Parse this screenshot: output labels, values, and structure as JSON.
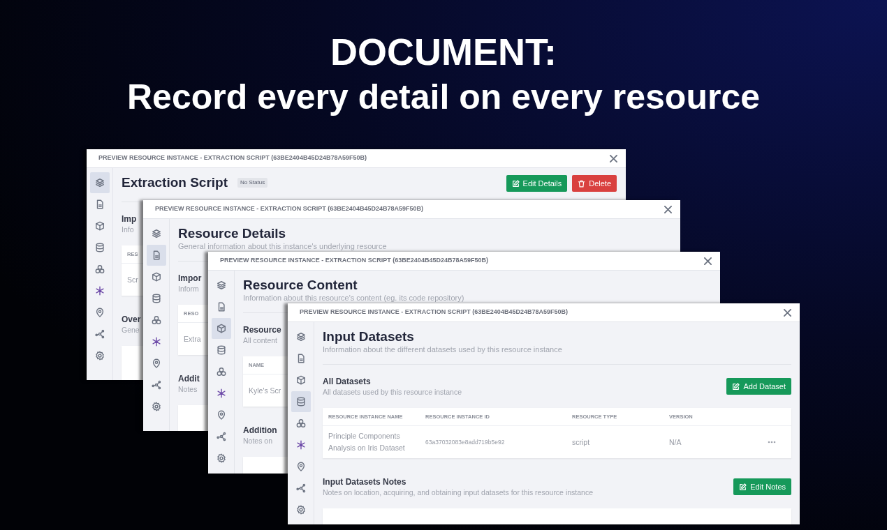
{
  "headline": {
    "title": "DOCUMENT:",
    "subtitle": "Record every detail on every resource"
  },
  "windows": [
    {
      "title": "PREVIEW RESOURCE INSTANCE - EXTRACTION SCRIPT (63BE2404B45D24B78A59F50B)",
      "nav": [
        {
          "selected": true
        },
        {
          "selected": false
        },
        {
          "selected": false
        },
        {
          "selected": false
        },
        {
          "selected": false
        },
        {
          "selected": false
        },
        {
          "selected": false
        },
        {
          "selected": false
        },
        {
          "selected": false
        }
      ],
      "heading": "Extraction Script",
      "badge": "No Status",
      "buttons": [
        {
          "kind": "edit",
          "label": "Edit Details"
        },
        {
          "kind": "delete",
          "label": "Delete"
        }
      ],
      "sections": [
        {
          "heading": "Imp",
          "description": "Info",
          "card": {
            "kind": "table",
            "columns": [
              "RES"
            ],
            "rows": [
              {
                "cells": [
                  "Scr"
                ]
              }
            ]
          }
        },
        {
          "heading": "Over",
          "description": "Gene",
          "card": {
            "kind": "blank"
          }
        }
      ]
    },
    {
      "title": "PREVIEW RESOURCE INSTANCE - EXTRACTION SCRIPT (63BE2404B45D24B78A59F50B)",
      "nav": [
        {
          "selected": false
        },
        {
          "selected": true
        },
        {
          "selected": false
        },
        {
          "selected": false
        },
        {
          "selected": false
        },
        {
          "selected": false
        },
        {
          "selected": false
        },
        {
          "selected": false
        },
        {
          "selected": false
        }
      ],
      "heading": "Resource Details",
      "description": "General information about this instance's underlying resource",
      "sections": [
        {
          "heading": "Impor",
          "description": "Inform",
          "card": {
            "kind": "table",
            "columns": [
              "RESO"
            ],
            "rows": [
              {
                "cells": [
                  "Extra"
                ]
              }
            ]
          }
        },
        {
          "heading": "Addit",
          "description": "Notes",
          "card": {
            "kind": "blank"
          }
        }
      ]
    },
    {
      "title": "PREVIEW RESOURCE INSTANCE - EXTRACTION SCRIPT (63BE2404B45D24B78A59F50B)",
      "nav": [
        {
          "selected": false
        },
        {
          "selected": false
        },
        {
          "selected": true
        },
        {
          "selected": false
        },
        {
          "selected": false
        },
        {
          "selected": false
        },
        {
          "selected": false
        },
        {
          "selected": false
        },
        {
          "selected": false
        }
      ],
      "heading": "Resource Content",
      "description": "Information about this resource's content (eg. its code repository)",
      "sections": [
        {
          "heading": "Resource",
          "description": "All content",
          "card": {
            "kind": "table",
            "columns": [
              "NAME"
            ],
            "rows": [
              {
                "cells": [
                  "Kyle's Scr"
                ]
              }
            ]
          }
        },
        {
          "heading": "Addition",
          "description": "Notes on",
          "card": {
            "kind": "blank"
          }
        }
      ]
    },
    {
      "title": "PREVIEW RESOURCE INSTANCE - EXTRACTION SCRIPT (63BE2404B45D24B78A59F50B)",
      "nav": [
        {
          "selected": false
        },
        {
          "selected": false
        },
        {
          "selected": false
        },
        {
          "selected": true
        },
        {
          "selected": false
        },
        {
          "selected": false
        },
        {
          "selected": false
        },
        {
          "selected": false
        },
        {
          "selected": false
        }
      ],
      "heading": "Input Datasets",
      "description": "Information about the different datasets used by this resource instance",
      "sections": [
        {
          "heading": "All Datasets",
          "description": "All datasets used by this resource instance",
          "button": "Add Dataset",
          "card": {
            "kind": "table",
            "columns": [
              "RESOURCE INSTANCE NAME",
              "RESOURCE INSTANCE ID",
              "RESOURCE TYPE",
              "VERSION"
            ],
            "rows": [
              {
                "cells": [
                  "Principle Components Analysis on Iris Dataset",
                  "63a37032083e8add719b5e92",
                  "script",
                  "N/A"
                ],
                "menu": true
              }
            ]
          }
        },
        {
          "heading": "Input Datasets Notes",
          "description": "Notes on location, acquiring, and obtaining input datasets for this resource instance",
          "button": "Edit Notes",
          "card": {
            "kind": "blank"
          }
        }
      ]
    }
  ]
}
